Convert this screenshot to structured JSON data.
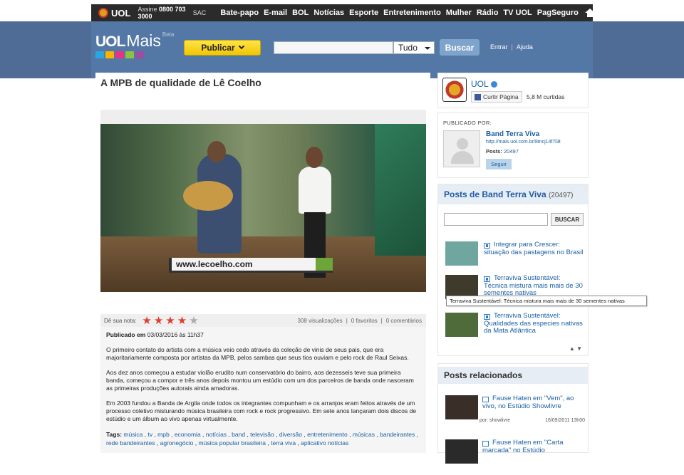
{
  "topbar": {
    "brand": "UOL",
    "assine_label": "Assine",
    "phone": "0800 703 3000",
    "sac": "SAC",
    "nav": [
      "Bate-papo",
      "E-mail",
      "BOL",
      "Notícias",
      "Esporte",
      "Entretenimento",
      "Mulher",
      "Rádio",
      "TV UOL",
      "PagSeguro"
    ],
    "home_icon": "home-icon"
  },
  "header": {
    "brand_uol": "UOL",
    "brand_mais": "Mais",
    "beta": "Beta",
    "publicar_label": "Publicar",
    "search_placeholder": "",
    "select_value": "Tudo",
    "buscar_label": "Buscar",
    "entrar": "Entrar",
    "ajuda": "Ajuda",
    "icon_colors": [
      "#2aa7e0",
      "#f7b500",
      "#e9308a",
      "#8bc43f",
      "#9b4fa3"
    ]
  },
  "main": {
    "title": "A MPB de qualidade de Lê Coelho",
    "video_caption": "www.lecoelho.com",
    "rating_label": "Dê sua nota:",
    "rating": 4,
    "rating_max": 5,
    "views": "308 visualizações",
    "favorites": "0 favoritos",
    "comments": "0 comentários",
    "published_label": "Publicado em",
    "published_date": "03/03/2016 às 11h37",
    "paragraphs": [
      "O primeiro contato do artista com a música veio cedo através da coleção de vinis de seus pais, que era majoritariamente composta por artistas da MPB, pelos sambas que seus tios ouviam e pelo rock de Raul Seixas.",
      "Aos dez anos começou a estudar violão erudito num conservatório do bairro, aos dezesseis teve sua primeira banda, começou a compor e três anos depois montou um estúdio com um dos parceiros de banda onde nasceram as primeiras produções autorais ainda amadoras.",
      "Em 2003 fundou a Banda de Argila onde todos os integrantes compunham e os arranjos eram feitos através de um processo coletivo misturando música brasileira com rock e rock progressivo. Em sete anos lançaram dois discos de estúdio e um álbum ao vivo apenas virtualmente."
    ],
    "tags_label": "Tags:",
    "tags": [
      "música",
      "tv",
      "mpb",
      "economia",
      "notícias",
      "band",
      "televisão",
      "diversão",
      "entretenimento",
      "músicas",
      "bandeirantes",
      "rede bandeirantes",
      "agronegócio",
      "música popular brasileira",
      "terra viva",
      "aplicativo notícias"
    ]
  },
  "channel": {
    "name": "UOL",
    "curtir_label": "Curtir Página",
    "likes": "5,8 M curtidas"
  },
  "publisher": {
    "label": "PUBLICADO POR:",
    "name": "Band Terra Viva",
    "url": "http://mais.uol.com.br/8tncj14f7l3t",
    "posts_label": "Posts:",
    "posts_count": "20497",
    "seguir_label": "Seguir"
  },
  "posts": {
    "title": "Posts de Band Terra Viva",
    "count": "(20497)",
    "search_button": "BUSCAR",
    "items": [
      {
        "title": "Integrar para Crescer: situação das pastagens no Brasil",
        "thumb_color": "#6fa7a0"
      },
      {
        "title": "Terraviva Sustentável: Técnica mistura mais mais de 30 sementes nativas",
        "thumb_color": "#3e3a2c"
      },
      {
        "title": "Terraviva Sustentável: Qualidades das especies nativas da Mata Atlântica",
        "thumb_color": "#4f6b3a"
      }
    ],
    "tooltip": "Terraviva Sustentável: Técnica mistura mais mais de 30 sementes nativas"
  },
  "related": {
    "title": "Posts relacionados",
    "items": [
      {
        "title": "Fause Haten em \"Vem\", ao vivo, no Estúdio Showlivre",
        "author": "por: showlivre",
        "date": "16/09/2011 13h00",
        "thumb_color": "#3a2e28"
      },
      {
        "title": "Fause Haten em \"Carta marcada\" no Estúdio",
        "author": "",
        "date": "",
        "thumb_color": "#2a2a2a"
      }
    ]
  }
}
